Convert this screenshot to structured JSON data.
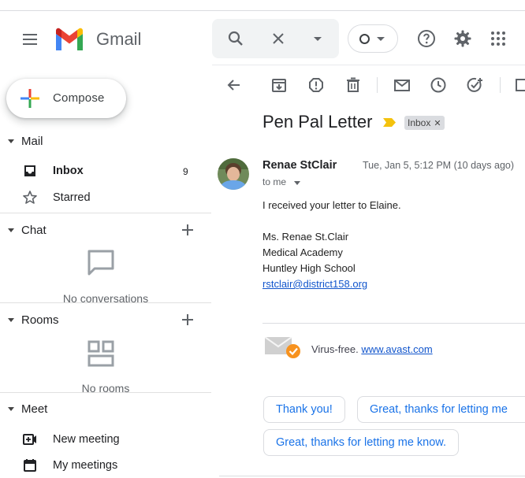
{
  "header": {
    "app_name": "Gmail"
  },
  "sidebar": {
    "compose_label": "Compose",
    "mail": {
      "title": "Mail",
      "items": [
        {
          "label": "Inbox",
          "count": "9",
          "icon": "inbox-icon"
        },
        {
          "label": "Starred",
          "count": "",
          "icon": "star-icon"
        }
      ]
    },
    "chat": {
      "title": "Chat",
      "empty_text": "No conversations"
    },
    "rooms": {
      "title": "Rooms",
      "empty_text": "No rooms"
    },
    "meet": {
      "title": "Meet",
      "items": [
        {
          "label": "New meeting",
          "icon": "video-icon"
        },
        {
          "label": "My meetings",
          "icon": "calendar-icon"
        }
      ]
    }
  },
  "email": {
    "subject": "Pen Pal Letter",
    "label_chip": "Inbox",
    "sender": "Renae StClair",
    "date": "Tue, Jan 5, 5:12 PM (10 days ago)",
    "to": "to me",
    "body": {
      "greeting": "I received your letter to Elaine.",
      "sig_name": "Ms. Renae St.Clair",
      "sig_dept": "Medical Academy",
      "sig_school": "Huntley High School",
      "sig_email": "rstclair@district158.org"
    },
    "virus_free_text": "Virus-free.",
    "virus_free_link": "www.avast.com"
  },
  "smart_replies": [
    "Thank you!",
    "Great, thanks for letting me",
    "Great, thanks for letting me know."
  ],
  "colors": {
    "accent_blue": "#1a73e8",
    "link_blue": "#1155cc",
    "marker_yellow": "#f4c20d",
    "avast_orange": "#f7921e"
  }
}
